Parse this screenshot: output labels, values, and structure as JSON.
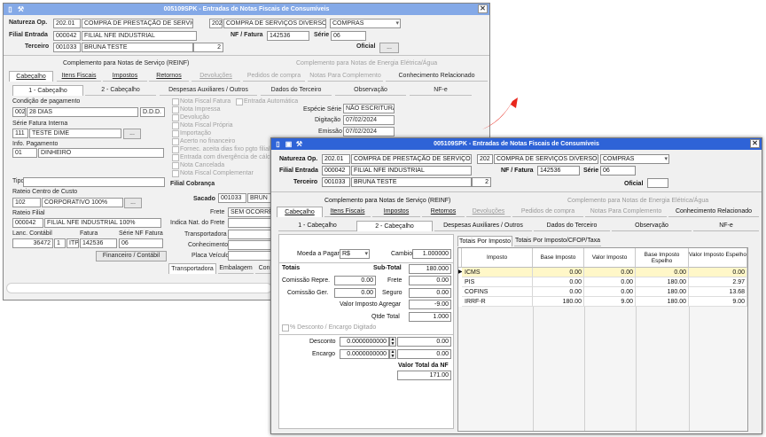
{
  "colors": {
    "title_active": "#2e63d7",
    "title_inactive": "#7aa2e6",
    "arrow": "#e8271d",
    "selected_row": "#fff7c8"
  },
  "back": {
    "title": "005109SPK - Entradas de Notas Fiscais de Consumíveis",
    "natureza_label": "Natureza Op.",
    "natureza_code": "202.01",
    "natureza_desc": "COMPRA DE PRESTAÇÃO DE SERVIÇOS",
    "sub_code": "202",
    "sub_desc": "COMPRA DE SERVIÇOS DIVERSOS",
    "tipo": "COMPRAS",
    "filial_label": "Filial Entrada",
    "filial_code": "000042",
    "filial_name": "FILIAL NFE INDUSTRIAL",
    "nf_label": "NF / Fatura",
    "nf_value": "142536",
    "serie_label": "Série",
    "serie_value": "06",
    "terceiro_label": "Terceiro",
    "terceiro_code": "001033",
    "terceiro_name": "BRUNA TESTE",
    "terceiro_num": "2",
    "oficial_label": "Oficial",
    "more": "...",
    "comp_servico": "Complemento para Notas de Serviço (REINF)",
    "comp_energia": "Complemento para Notas de Energia Elétrica/Água",
    "tabs": [
      "Cabeçalho",
      "Itens Fiscais",
      "Impostos",
      "Retornos",
      "Devoluções",
      "Pedidos de compra",
      "Notas Para Complemento",
      "Conhecimento Relacionado"
    ],
    "subtabs": [
      "1 - Cabeçalho",
      "2 - Cabeçalho",
      "Despesas Auxiliares / Outros",
      "Dados do Terceiro",
      "Observação",
      "NF-e"
    ],
    "cond_label": "Condição de pagamento",
    "cond_code": "002",
    "cond_desc": "28 DIAS",
    "cond_type": "D.D.D.",
    "serie_fat_label": "Série Fatura Interna",
    "serie_fat_code": "111",
    "serie_fat_desc": "TESTE DIME",
    "info_pag_label": "Info. Pagamento",
    "info_pag_code": "01",
    "info_pag_desc": "DINHEIRO",
    "tipo_label": "Tipo",
    "rateio_cc_label": "Rateio Centro de Custo",
    "rateio_cc_code": "102",
    "rateio_cc_desc": "CORPORATIVO 100%",
    "rateio_fil_label": "Rateio Filial",
    "rateio_fil_code": "000042",
    "rateio_fil_desc": "FILIAL NFE INDUSTRIAL 100%",
    "lanc_label": "Lanc. Contábil",
    "fatura_label": "Fatura",
    "serie_nf_label": "Série NF Fatura",
    "lanc_value": "36472",
    "lanc_seq": "1",
    "lanc_type": "ITP",
    "fatura_value": "142536",
    "serie_nf_value": "06",
    "fin_button": "Financeiro / Contábil",
    "checks": [
      "Nota Fiscal Fatura",
      "Entrada Automática",
      "Nota Impressa",
      "Devolução",
      "Nota Fiscal Própria",
      "Importação",
      "Acerto no financeiro",
      "Fornec. aceita dias fixo pgto filial",
      "Entrada com divergência de cálculo",
      "Nota Cancelada",
      "Nota Fiscal Complementar"
    ],
    "especie_label": "Espécie Série",
    "especie_value": "NÃO ESCRITURAÇ",
    "digitacao_label": "Digitação",
    "digitacao_value": "07/02/2024",
    "emissao_label": "Emissão",
    "emissao_value": "07/02/2024",
    "filial_cobranca_label": "Filial Cobrança",
    "sacado_label": "Sacado",
    "sacado_code": "001033",
    "sacado_name": "BRUN",
    "frete_label": "Frete",
    "frete_value": "SEM OCORRÊN",
    "indica_label": "Indica Nat. do Frete",
    "transp_label": "Transportadora",
    "conhec_label": "Conhecimento",
    "placa_label": "Placa Veículo",
    "bottom_tabs": [
      "Transportadora",
      "Embalagem",
      "Con"
    ]
  },
  "front": {
    "title": "005109SPK - Entradas de Notas Fiscais de Consumíveis",
    "natureza_label": "Natureza Op.",
    "natureza_code": "202.01",
    "natureza_desc": "COMPRA DE PRESTAÇÃO DE SERVIÇOS",
    "sub_code": "202",
    "sub_desc": "COMPRA DE SERVIÇOS DIVERSOS",
    "tipo": "COMPRAS",
    "filial_label": "Filial Entrada",
    "filial_code": "000042",
    "filial_name": "FILIAL NFE INDUSTRIAL",
    "nf_label": "NF / Fatura",
    "nf_value": "142536",
    "serie_label": "Série",
    "serie_value": "06",
    "terceiro_label": "Terceiro",
    "terceiro_code": "001033",
    "terceiro_name": "BRUNA TESTE",
    "terceiro_num": "2",
    "oficial_label": "Oficial",
    "comp_servico": "Complemento para Notas de Serviço (REINF)",
    "comp_energia": "Complemento para Notas de Energia Elétrica/Água",
    "tabs": [
      "Cabeçalho",
      "Itens Fiscais",
      "Impostos",
      "Retornos",
      "Devoluções",
      "Pedidos de compra",
      "Notas Para Complemento",
      "Conhecimento Relacionado"
    ],
    "subtabs": [
      "1 - Cabeçalho",
      "2 - Cabeçalho",
      "Despesas Auxiliares / Outros",
      "Dados do Terceiro",
      "Observação",
      "NF-e"
    ],
    "moeda_label": "Moeda a Pagar",
    "moeda_value": "R$",
    "cambio_label": "Cambio",
    "cambio_value": "1.000000",
    "totais_label": "Totais",
    "subtotal_label": "Sub-Total",
    "subtotal_value": "180.000",
    "comissao_repre_label": "Comissão Repre.",
    "comissao_repre_value": "0.00",
    "frete_label": "Frete",
    "frete_value": "0.00",
    "comissao_ger_label": "Comissão Ger.",
    "comissao_ger_value": "0.00",
    "seguro_label": "Seguro",
    "seguro_value": "0.00",
    "valor_imposto_label": "Valor Imposto Agregar",
    "valor_imposto_value": "-9.00",
    "qtde_label": "Qtde Total",
    "qtde_value": "1.000",
    "desconto_check_label": "% Desconto / Encargo Digitado",
    "desconto_label": "Desconto",
    "desconto_pct": "0.0000000000",
    "desconto_value": "0.00",
    "encargo_label": "Encargo",
    "encargo_pct": "0.0000000000",
    "encargo_value": "0.00",
    "valor_total_label": "Valor Total da NF",
    "valor_total_value": "171.00",
    "right_tabs": [
      "Totais Por Imposto",
      "Totais Por Imposto/CFOP/Taxa"
    ],
    "table": {
      "headers": [
        "Imposto",
        "Base Imposto",
        "Valor Imposto",
        "Base Imposto Espelho",
        "Valor Imposto Espelho"
      ],
      "rows": [
        [
          "ICMS",
          "0.00",
          "0.00",
          "0.00",
          "0.00"
        ],
        [
          "PIS",
          "0.00",
          "0.00",
          "180.00",
          "2.97"
        ],
        [
          "COFINS",
          "0.00",
          "0.00",
          "180.00",
          "13.68"
        ],
        [
          "IRRF-R",
          "180.00",
          "9.00",
          "180.00",
          "9.00"
        ]
      ]
    }
  }
}
